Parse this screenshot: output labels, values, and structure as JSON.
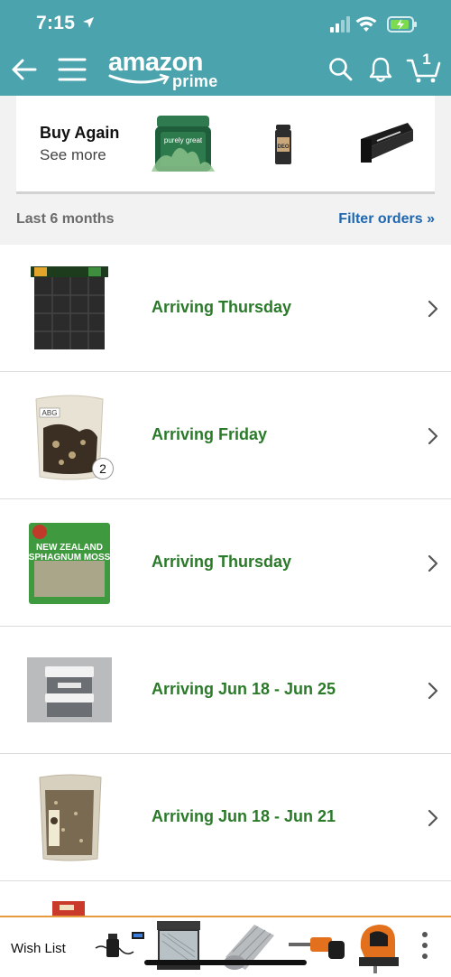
{
  "status_bar": {
    "time": "7:15"
  },
  "header": {
    "logo_word": "amazon",
    "logo_sub": "prime",
    "cart_count": "1",
    "icons": [
      "back-arrow-icon",
      "menu-icon",
      "search-icon",
      "bell-icon",
      "cart-icon"
    ]
  },
  "buy_again": {
    "title": "Buy Again",
    "link": "See more",
    "product_brand_text": "purely great",
    "deo_text": "DEO"
  },
  "orders_header": {
    "range": "Last 6 months",
    "filter": "Filter orders »"
  },
  "orders": [
    {
      "status": "Arriving Thursday",
      "image_text": ""
    },
    {
      "status": "Arriving Friday",
      "image_text": "ABG",
      "quantity": "2"
    },
    {
      "status": "Arriving Thursday",
      "image_text": "NEW ZEALAND SPHAGNUM MOSS"
    },
    {
      "status": "Arriving Jun 18 - Jun 25",
      "image_text": ""
    },
    {
      "status": "Arriving Jun 18 - Jun 21",
      "image_text": ""
    }
  ],
  "bottom_bar": {
    "label": "Wish List"
  },
  "colors": {
    "header": "#4aa3ad",
    "status_green": "#2a7a2a",
    "link_blue": "#1f67b1",
    "bottom_accent": "#e79a3c"
  }
}
